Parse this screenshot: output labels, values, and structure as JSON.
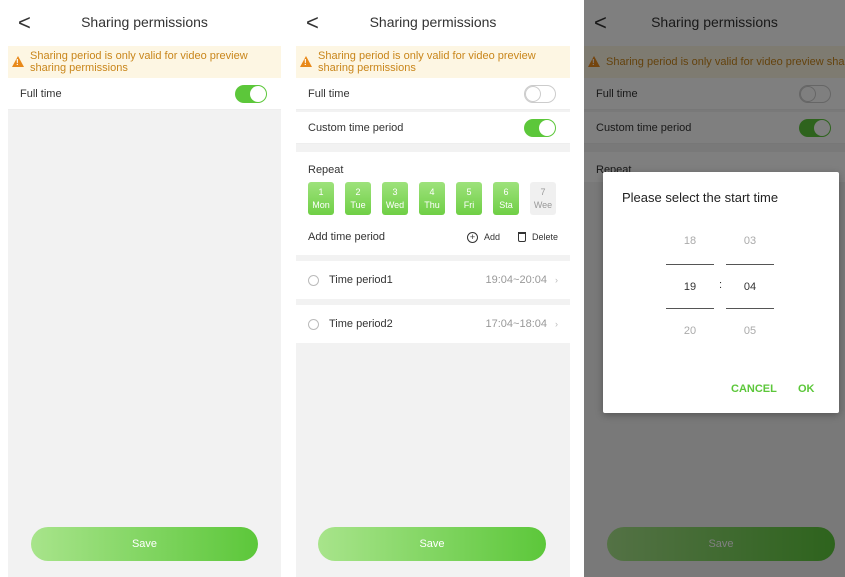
{
  "header": {
    "back_glyph": "<",
    "title": "Sharing permissions"
  },
  "notice": {
    "text": "Sharing period is only valid for video preview sharing permissions"
  },
  "full_time": {
    "label": "Full time"
  },
  "custom_period": {
    "label": "Custom time period"
  },
  "repeat": {
    "label": "Repeat",
    "days": [
      {
        "num": "1",
        "name": "Mon",
        "selected": true
      },
      {
        "num": "2",
        "name": "Tue",
        "selected": true
      },
      {
        "num": "3",
        "name": "Wed",
        "selected": true
      },
      {
        "num": "4",
        "name": "Thu",
        "selected": true
      },
      {
        "num": "5",
        "name": "Fri",
        "selected": true
      },
      {
        "num": "6",
        "name": "Sta",
        "selected": true
      },
      {
        "num": "7",
        "name": "Wee",
        "selected": false
      }
    ]
  },
  "add_period": {
    "label": "Add time period",
    "add_label": "Add",
    "delete_label": "Delete"
  },
  "periods": [
    {
      "name": "Time period1",
      "range": "19:04~20:04"
    },
    {
      "name": "Time period2",
      "range": "17:04~18:04"
    }
  ],
  "save_label": "Save",
  "dialog": {
    "title": "Please select the start time",
    "hours": [
      "18",
      "19",
      "20"
    ],
    "minutes": [
      "03",
      "04",
      "05"
    ],
    "separator": ":",
    "cancel_label": "CANCEL",
    "ok_label": "OK"
  },
  "colors": {
    "accent": "#5cc73a",
    "notice_text": "#c9861b",
    "notice_bg": "#fdf6e3"
  }
}
